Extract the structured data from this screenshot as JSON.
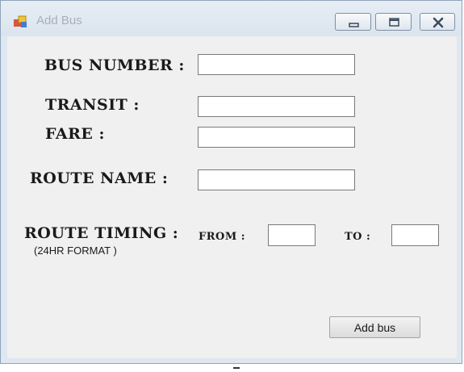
{
  "window": {
    "title": "Add Bus",
    "icon": "app-form-icon",
    "controls": [
      "minimize-icon",
      "maximize-icon",
      "close-icon"
    ]
  },
  "form": {
    "bus_number_label": "BUS NUMBER :",
    "transit_label": "TRANSIT :",
    "fare_label": "FARE :",
    "route_name_label": "ROUTE NAME :",
    "route_timing_label": "ROUTE TIMING  :",
    "route_timing_note": "(24HR FORMAT )",
    "from_label": "FROM :",
    "to_label": "TO :",
    "bus_number_value": "",
    "transit_value": "",
    "fare_value": "",
    "route_name_value": "",
    "from_value": "",
    "to_value": ""
  },
  "actions": {
    "add_bus_label": "Add bus"
  }
}
